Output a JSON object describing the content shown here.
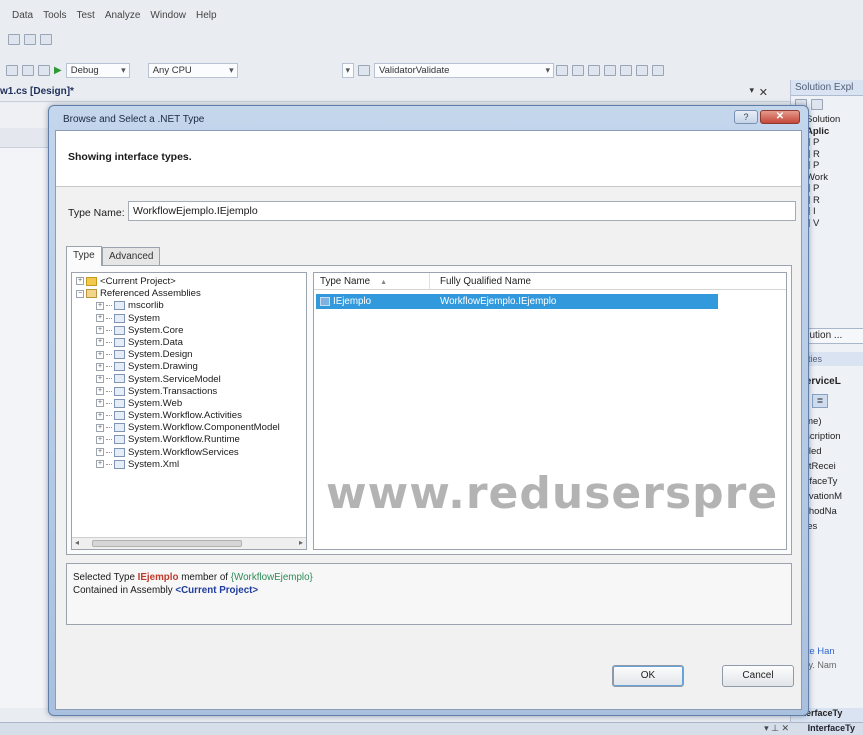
{
  "ide": {
    "menu": [
      "Data",
      "Tools",
      "Test",
      "Analyze",
      "Window",
      "Help"
    ],
    "toolbar": {
      "config": "Debug",
      "platform": "Any CPU",
      "target": "ValidatorValidate"
    },
    "document_tab": "w1.cs [Design]*",
    "close_glyph": "✕",
    "pin_glyph": "▾"
  },
  "right_panel": {
    "solution_title": "Solution Expl",
    "tree": [
      {
        "label": "Solution",
        "bold": false
      },
      {
        "label": "Aplic",
        "bold": true
      },
      {
        "label": "P",
        "bold": false
      },
      {
        "label": "R",
        "bold": false
      },
      {
        "label": "P",
        "bold": false
      },
      {
        "label": "Work",
        "bold": false
      },
      {
        "label": "P",
        "bold": false
      },
      {
        "label": "R",
        "bold": false
      },
      {
        "label": "I",
        "bold": false
      },
      {
        "label": "V",
        "bold": false
      }
    ],
    "solution_tab": "Solution ...",
    "properties_title": "perties",
    "properties_object": "bServiceL",
    "properties": [
      "Name)",
      "Description",
      "nabled",
      "nputRecei",
      "nterfaceTy",
      "ActivationM",
      "MethodNa",
      "Roles"
    ],
    "link": "erate Han",
    "link2": "perty. Nam",
    "bottom": "InterfaceTy"
  },
  "dialog": {
    "title": "Browse and Select a .NET Type",
    "help_glyph": "?",
    "close_glyph": "✕",
    "header_text": "Showing interface types.",
    "type_name_label": "Type Name:",
    "type_name_value": "WorkflowEjemplo.IEjemplo",
    "tabs": [
      "Type",
      "Advanced"
    ],
    "tree": [
      {
        "label": "<Current Project>",
        "indent": 0,
        "expander": "+",
        "icon": "proj"
      },
      {
        "label": "Referenced Assemblies",
        "indent": 0,
        "expander": "−",
        "icon": "refs"
      },
      {
        "label": "mscorlib",
        "indent": 1,
        "expander": "+",
        "icon": "asm"
      },
      {
        "label": "System",
        "indent": 1,
        "expander": "+",
        "icon": "asm"
      },
      {
        "label": "System.Core",
        "indent": 1,
        "expander": "+",
        "icon": "asm"
      },
      {
        "label": "System.Data",
        "indent": 1,
        "expander": "+",
        "icon": "asm"
      },
      {
        "label": "System.Design",
        "indent": 1,
        "expander": "+",
        "icon": "asm"
      },
      {
        "label": "System.Drawing",
        "indent": 1,
        "expander": "+",
        "icon": "asm"
      },
      {
        "label": "System.ServiceModel",
        "indent": 1,
        "expander": "+",
        "icon": "asm"
      },
      {
        "label": "System.Transactions",
        "indent": 1,
        "expander": "+",
        "icon": "asm"
      },
      {
        "label": "System.Web",
        "indent": 1,
        "expander": "+",
        "icon": "asm"
      },
      {
        "label": "System.Workflow.Activities",
        "indent": 1,
        "expander": "+",
        "icon": "asm"
      },
      {
        "label": "System.Workflow.ComponentModel",
        "indent": 1,
        "expander": "+",
        "icon": "asm"
      },
      {
        "label": "System.Workflow.Runtime",
        "indent": 1,
        "expander": "+",
        "icon": "asm"
      },
      {
        "label": "System.WorkflowServices",
        "indent": 1,
        "expander": "+",
        "icon": "asm"
      },
      {
        "label": "System.Xml",
        "indent": 1,
        "expander": "+",
        "icon": "asm"
      }
    ],
    "list": {
      "columns": [
        "Type Name",
        "Fully Qualified Name"
      ],
      "sort_glyph": "▲",
      "rows": [
        {
          "type_name": "IEjemplo",
          "qualified_name": "WorkflowEjemplo.IEjemplo",
          "selected": true
        }
      ]
    },
    "info": {
      "line1_prefix": "Selected Type ",
      "line1_type": "IEjemplo",
      "line1_mid": " member of ",
      "line1_ns": "{WorkflowEjemplo}",
      "line2_prefix": "Contained in Assembly ",
      "line2_assembly": "<Current Project>"
    },
    "buttons": {
      "ok": "OK",
      "cancel": "Cancel"
    }
  },
  "watermark": "www.reduserspre",
  "colors": {
    "selection": "#3399dd",
    "close_button": "#c4463a",
    "frame": "#a9c0de"
  }
}
